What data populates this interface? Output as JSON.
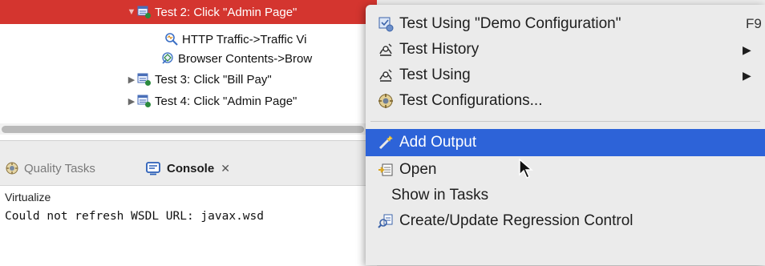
{
  "tree": {
    "items": [
      {
        "label": "Test 2: Click \"Admin Page\"",
        "icon": "test-suite-icon",
        "expanded": true,
        "selected": true
      },
      {
        "label": "HTTP Traffic->Traffic Vi",
        "icon": "traffic-viewer-icon"
      },
      {
        "label": "Browser Contents->Brow",
        "icon": "browser-contents-icon"
      },
      {
        "label": "Test 3: Click \"Bill Pay\"",
        "icon": "test-suite-icon",
        "expanded": false
      },
      {
        "label": "Test 4: Click \"Admin Page\"",
        "icon": "test-suite-icon",
        "expanded": false
      }
    ]
  },
  "views": {
    "tabs": [
      {
        "label": "Quality Tasks",
        "icon": "quality-tasks-icon",
        "active": false
      },
      {
        "label": "Console",
        "icon": "console-icon",
        "active": true,
        "close": "✕"
      }
    ]
  },
  "console": {
    "title": "Virtualize",
    "line": "Could not refresh WSDL URL: javax.wsd"
  },
  "context_menu": {
    "items": [
      {
        "label": "Test Using \"Demo Configuration\"",
        "shortcut": "F9",
        "icon": "test-config-icon"
      },
      {
        "label": "Test History",
        "submenu": "▶",
        "icon": "test-history-icon"
      },
      {
        "label": "Test Using",
        "submenu": "▶",
        "icon": "test-using-icon"
      },
      {
        "label": "Test Configurations...",
        "icon": "configurations-icon"
      },
      {
        "label": "Add Output",
        "icon": "add-output-icon",
        "highlighted": true
      },
      {
        "label": "Open",
        "icon": "open-icon"
      },
      {
        "label": "Show in Tasks"
      },
      {
        "label": "Create/Update Regression Control",
        "icon": "regression-control-icon"
      }
    ]
  },
  "colors": {
    "selection_red": "#d4352f",
    "menu_highlight": "#2d63d8",
    "menu_background": "#ebebeb"
  }
}
